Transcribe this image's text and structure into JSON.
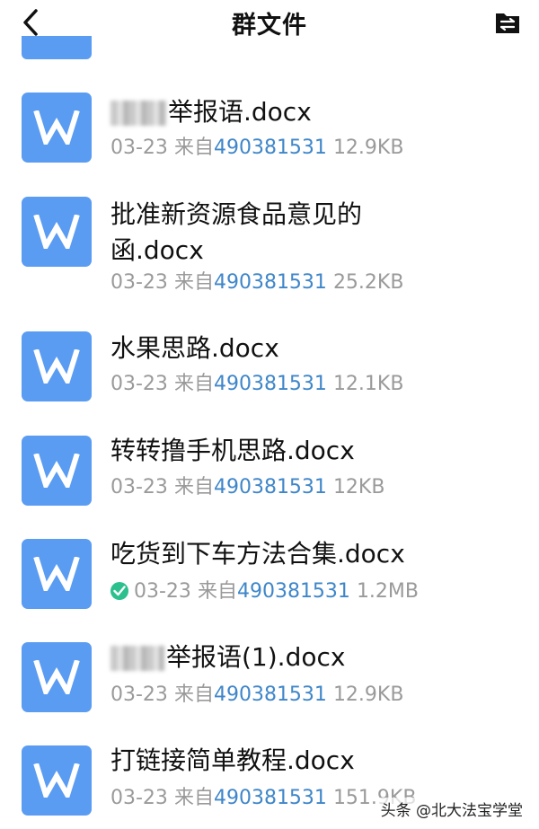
{
  "header": {
    "title": "群文件",
    "back_icon": "chevron-left-icon",
    "sort_icon": "swap-file-icon"
  },
  "files": [
    {
      "name": "举报语.docx",
      "date": "03-23",
      "from_label": "来自",
      "uploader": "490381531",
      "size": "12.9KB"
    },
    {
      "name": "批准新资源食品意见的函.docx",
      "date": "03-23",
      "from_label": "来自",
      "uploader": "490381531",
      "size": "25.2KB"
    },
    {
      "name": "水果思路.docx",
      "date": "03-23",
      "from_label": "来自",
      "uploader": "490381531",
      "size": "12.1KB"
    },
    {
      "name": "转转撸手机思路.docx",
      "date": "03-23",
      "from_label": "来自",
      "uploader": "490381531",
      "size": "12KB"
    },
    {
      "name": "吃货到下车方法合集.docx",
      "date": "03-23",
      "from_label": "来自",
      "uploader": "490381531",
      "size": "1.2MB",
      "downloaded": true
    },
    {
      "name": "举报语(1).docx",
      "date": "03-23",
      "from_label": "来自",
      "uploader": "490381531",
      "size": "12.9KB"
    },
    {
      "name": "打链接简单教程.docx",
      "date": "03-23",
      "from_label": "来自",
      "uploader": "490381531",
      "size": "151.9KB"
    }
  ],
  "watermark": "头条 @北大法宝学堂",
  "colors": {
    "file_icon": "#5a9cf2",
    "uploader_link": "#3f86c9",
    "meta_text": "#9a9a9a",
    "downloaded_check": "#2bc08d"
  }
}
